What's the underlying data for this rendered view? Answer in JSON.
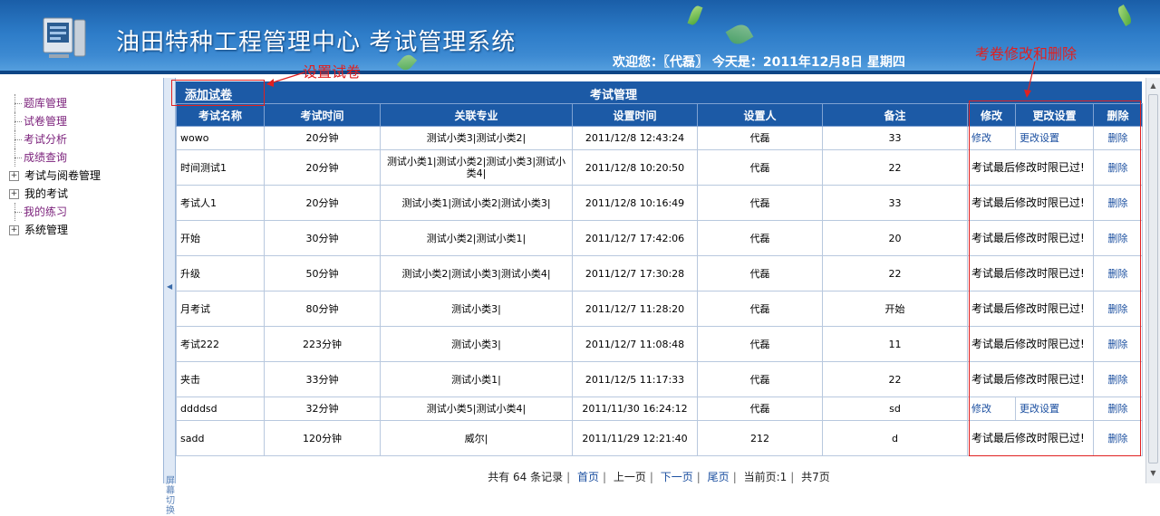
{
  "header": {
    "app_title": "油田特种工程管理中心  考试管理系统",
    "welcome": "欢迎您：〖代磊〗 今天是：2011年12月8日 星期四"
  },
  "sidebar": {
    "items": [
      {
        "label": "题库管理",
        "kind": "leaf"
      },
      {
        "label": "试卷管理",
        "kind": "leaf"
      },
      {
        "label": "考试分析",
        "kind": "leaf"
      },
      {
        "label": "成绩查询",
        "kind": "leaf"
      },
      {
        "label": "考试与阅卷管理",
        "kind": "branch"
      },
      {
        "label": "我的考试",
        "kind": "branch"
      },
      {
        "label": "我的练习",
        "kind": "leaf"
      },
      {
        "label": "系统管理",
        "kind": "branch"
      }
    ],
    "splitter_text": "屏幕切换"
  },
  "main": {
    "add_exam": "添加试卷",
    "title": "考试管理",
    "columns": [
      "考试名称",
      "考试时间",
      "关联专业",
      "设置时间",
      "设置人",
      "备注",
      "修改",
      "更改设置",
      "删除"
    ],
    "rows": [
      {
        "name": "wowo",
        "time": "20分钟",
        "major": "测试小类3|测试小类2|",
        "set_time": "2011/12/8 12:43:24",
        "setter": "代磊",
        "note": "33",
        "editable": true
      },
      {
        "name": "时间测试1",
        "time": "20分钟",
        "major": "测试小类1|测试小类2|测试小类3|测试小类4|",
        "set_time": "2011/12/8 10:20:50",
        "setter": "代磊",
        "note": "22",
        "editable": false
      },
      {
        "name": "考试人1",
        "time": "20分钟",
        "major": "测试小类1|测试小类2|测试小类3|",
        "set_time": "2011/12/8 10:16:49",
        "setter": "代磊",
        "note": "33",
        "editable": false
      },
      {
        "name": "开始",
        "time": "30分钟",
        "major": "测试小类2|测试小类1|",
        "set_time": "2011/12/7 17:42:06",
        "setter": "代磊",
        "note": "20",
        "editable": false
      },
      {
        "name": "升级",
        "time": "50分钟",
        "major": "测试小类2|测试小类3|测试小类4|",
        "set_time": "2011/12/7 17:30:28",
        "setter": "代磊",
        "note": "22",
        "editable": false
      },
      {
        "name": "月考试",
        "time": "80分钟",
        "major": "测试小类3|",
        "set_time": "2011/12/7 11:28:20",
        "setter": "代磊",
        "note": "开始",
        "editable": false
      },
      {
        "name": "考试222",
        "time": "223分钟",
        "major": "测试小类3|",
        "set_time": "2011/12/7 11:08:48",
        "setter": "代磊",
        "note": "11",
        "editable": false
      },
      {
        "name": "夹击",
        "time": "33分钟",
        "major": "测试小类1|",
        "set_time": "2011/12/5 11:17:33",
        "setter": "代磊",
        "note": "22",
        "editable": false
      },
      {
        "name": "ddddsd",
        "time": "32分钟",
        "major": "测试小类5|测试小类4|",
        "set_time": "2011/11/30 16:24:12",
        "setter": "代磊",
        "note": "sd",
        "editable": true
      },
      {
        "name": "sadd",
        "time": "120分钟",
        "major": "威尔|",
        "set_time": "2011/11/29 12:21:40",
        "setter": "212",
        "note": "d",
        "editable": false
      }
    ],
    "edit_label": "修改",
    "change_settings_label": "更改设置",
    "delete_label": "删除",
    "expired_text": "考试最后修改时限已过!",
    "pager": {
      "total": "共有 64 条记录",
      "first": "首页",
      "prev": "上一页",
      "next": "下一页",
      "last": "尾页",
      "current": "当前页:1",
      "pages": "共7页"
    }
  },
  "annotations": {
    "set_exam": "设置试卷",
    "edit_delete": "考卷修改和删除",
    "color": "#e02020"
  }
}
